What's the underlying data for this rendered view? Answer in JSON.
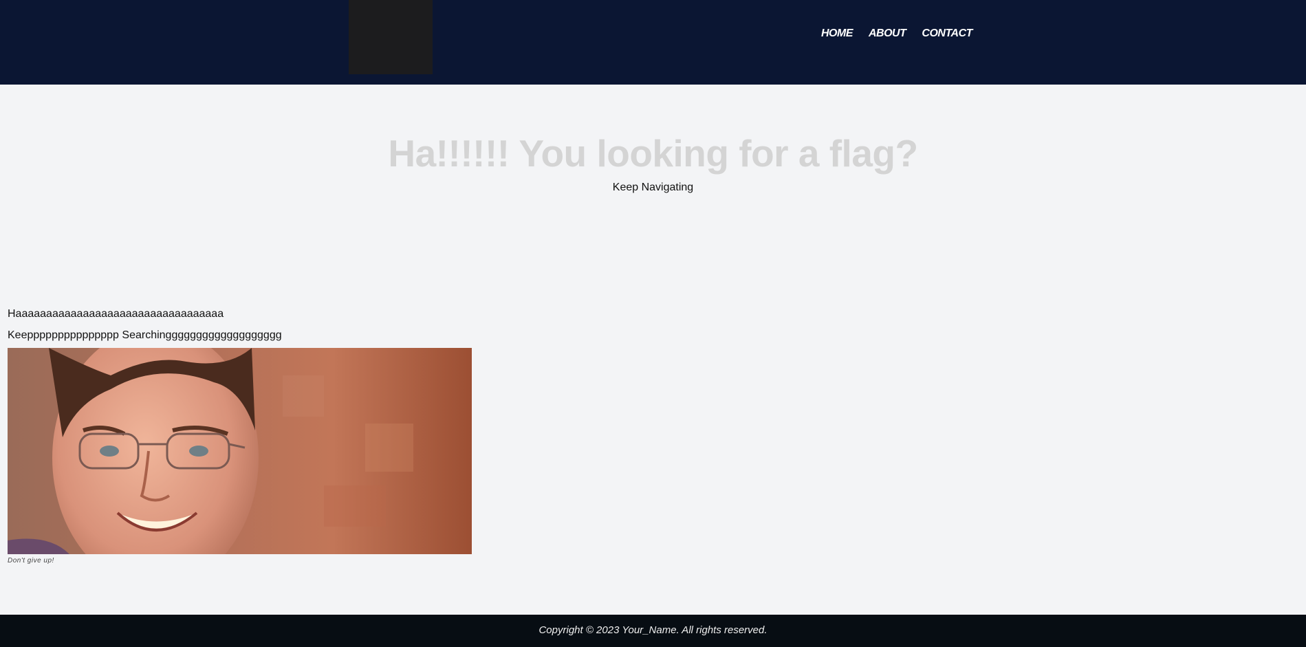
{
  "header": {
    "nav": [
      {
        "label": "HOME"
      },
      {
        "label": "ABOUT"
      },
      {
        "label": "CONTACT"
      }
    ]
  },
  "hero": {
    "title": "Ha!!!!!! You looking for a flag?",
    "subtitle": "Keep Navigating"
  },
  "content": {
    "line1": "Haaaaaaaaaaaaaaaaaaaaaaaaaaaaaaaaaa",
    "line2": "Keeppppppppppppppp Searchinggggggggggggggggggg",
    "image_caption": "Don't give up!"
  },
  "footer": {
    "copyright": "Copyright © 2023 Your_Name. All rights reserved."
  },
  "colors": {
    "header_bg": "#0b1633",
    "page_bg": "#f3f4f6",
    "footer_bg": "#070d13",
    "hero_title": "#d4d4d4"
  }
}
